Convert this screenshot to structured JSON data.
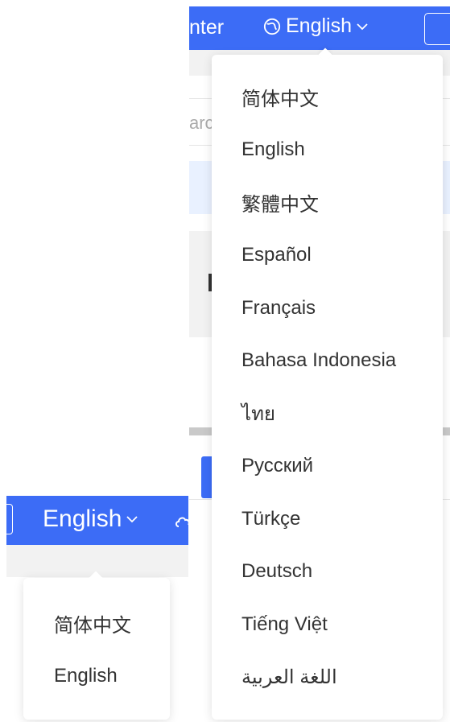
{
  "header_a": {
    "left_fragment": "nter",
    "language_label": "English"
  },
  "search_fragment": "arc",
  "menu_a": {
    "items": [
      {
        "label": "简体中文"
      },
      {
        "label": "English"
      },
      {
        "label": "繁體中文"
      },
      {
        "label": "Español"
      },
      {
        "label": "Français"
      },
      {
        "label": "Bahasa Indonesia"
      },
      {
        "label": "ไทย"
      },
      {
        "label": "Русский"
      },
      {
        "label": "Türkçe"
      },
      {
        "label": "Deutsch"
      },
      {
        "label": "Tiếng Việt"
      },
      {
        "label": "اللغة العربية"
      }
    ]
  },
  "header_b": {
    "language_label": "English"
  },
  "menu_b": {
    "items": [
      {
        "label": "简体中文"
      },
      {
        "label": "English"
      }
    ]
  },
  "colors": {
    "header_blue": "#3c6cf6",
    "highlight_blue": "#e9f1ff"
  }
}
